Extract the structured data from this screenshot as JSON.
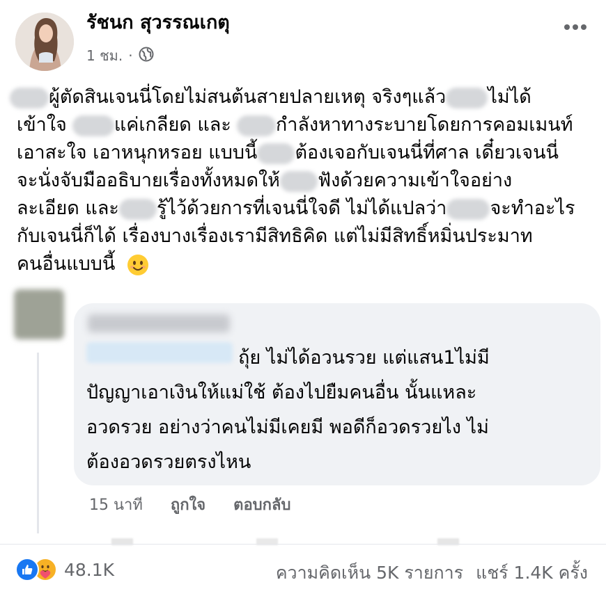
{
  "post": {
    "author": "รัชนก สุวรรณเกตุ",
    "time": "1 ชม.",
    "dot": "·",
    "lines": [
      {
        "a": "",
        "b": "ผู้ตัดสินเจนนี่โดยไม่สนต้นสายปลายเหตุ จริงๆแล้ว",
        "c": "ไม่ได้"
      },
      {
        "a": "เข้าใจ",
        "b": "แค่เกลียด และ",
        "c": "กำลังหาทางระบายโดยการคอมเมนท์"
      },
      {
        "a": "เอาสะใจ เอาหนุกหรอย แบบนี้",
        "b": "ต้องเจอกับเจนนี่ที่ศาล เดี๋ยวเจนนี่",
        "c": ""
      },
      {
        "a": "จะนั่งจับมืออธิบายเรื่องทั้งหมดให้",
        "b": "ฟังด้วยความเข้าใจอย่าง",
        "c": ""
      },
      {
        "a": "ละเอียด และ",
        "b": "รู้ไว้ด้วยการที่เจนนี่ใจดี ไม่ได้แปลว่า",
        "c": "จะทำอะไร"
      },
      {
        "a": "กับเจนนี่ก็ได้ เรื่องบางเรื่องเรามีสิทธิคิด แต่ไม่มีสิทธิ์หมิ่นประมาท",
        "b": "",
        "c": ""
      },
      {
        "a": "คนอื่นแบบนี้",
        "b": "",
        "c": ""
      }
    ]
  },
  "comment": {
    "lines": [
      "ถุ้ย ไม่ได้อวนรวย แต่แสน1ไม่มี",
      "ปัญญาเอาเงินให้แม่ใช้ ต้องไปยืมคนอื่น นั้นแหละ",
      "อวดรวย อย่างว่าคนไม่มีเคยมี พอดีก็อวดรวยไง ไม่",
      "ต้องอวดรวยตรงไหน"
    ],
    "time": "15 นาที",
    "like_label": "ถูกใจ",
    "reply_label": "ตอบกลับ"
  },
  "footer": {
    "reaction_count": "48.1K",
    "comments_label": "ความคิดเห็น 5K รายการ",
    "shares_label": "แชร์ 1.4K ครั้ง"
  },
  "icons": {
    "globe": "globe-icon",
    "more": "more-options-icon",
    "emoji": "smiling-face-emoji",
    "like": "like-reaction-icon",
    "care": "care-reaction-icon"
  },
  "colors": {
    "like_blue": "#1877f2",
    "care_yellow": "#f7b125",
    "secondary_text": "#65676b",
    "bubble_bg": "#f0f2f5"
  }
}
